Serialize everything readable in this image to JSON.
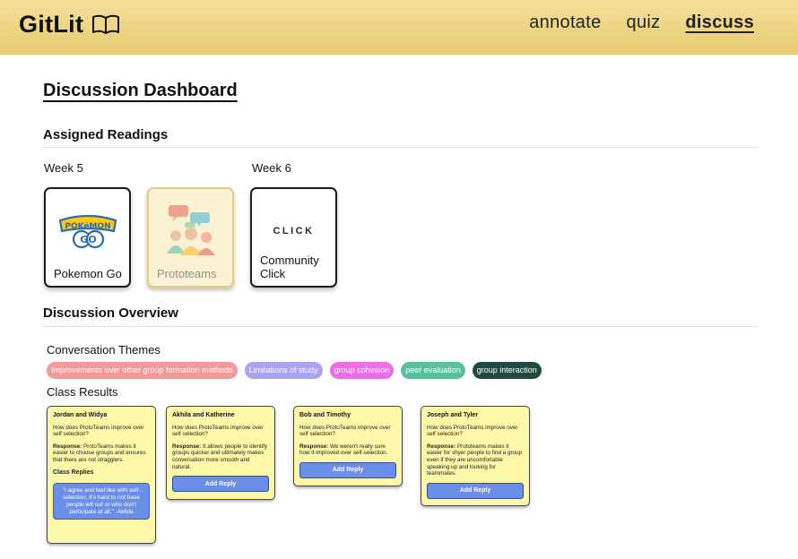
{
  "header": {
    "brand": "GitLit",
    "nav": [
      {
        "label": "annotate",
        "active": false
      },
      {
        "label": "quiz",
        "active": false
      },
      {
        "label": "discuss",
        "active": true
      }
    ]
  },
  "page_title": "Discussion Dashboard",
  "assigned": {
    "title": "Assigned Readings",
    "weeks": [
      {
        "label": "Week 5"
      },
      {
        "label": "Week 6"
      }
    ],
    "cards": [
      {
        "label": "Pokemon Go",
        "image": "pokemon-go-logo",
        "selected": false
      },
      {
        "label": "Prototeams",
        "image": "people-chat-illustration",
        "selected": true
      },
      {
        "label": "Community Click",
        "image": "click-logo",
        "logo_text": "CLICK",
        "selected": false
      }
    ]
  },
  "overview": {
    "title": "Discussion Overview",
    "themes_title": "Conversation Themes",
    "themes": [
      {
        "label": "Improvements over other group formation methods",
        "color": "#f19a9a"
      },
      {
        "label": "Limitations of study",
        "color": "#a9a3f0"
      },
      {
        "label": "group cohesion",
        "color": "#ea6fe3"
      },
      {
        "label": "peer evaluation",
        "color": "#5bbf9f"
      },
      {
        "label": "group interaction",
        "color": "#234a40"
      }
    ],
    "results_title": "Class Results",
    "results": [
      {
        "names": "Jordan and Widya",
        "question": "How does ProtoTeams improve over self selection?",
        "response_label": "Response:",
        "response": "ProtoTeams makes it easier to choose groups and ensures that there are not stragglers.",
        "replies_title": "Class Replies",
        "reply": "\"I agree and feel like with self-selection, it's hard to not have people left out or who don't participate at all.\" -Akhila"
      },
      {
        "names": "Akhila and Katherine",
        "question": "How does ProtoTeams improve over self selection?",
        "response_label": "Response:",
        "response": "It allows people to identify groups quicker and ultimately makes conversation more smooth and natural.",
        "button": "Add Reply"
      },
      {
        "names": "Bob and Timothy",
        "question": "How does ProtoTeams improve over self selection?",
        "response_label": "Response:",
        "response": "We weren't really sure how it improved over self-selection.",
        "button": "Add Reply"
      },
      {
        "names": "Joseph and Tyler",
        "question": "How does ProtoTeams improve over self selection?",
        "response_label": "Response:",
        "response": "Prototeams makes it easier for shyer people to find a group even if they are uncomfortable speaking up and looking for teammates.",
        "button": "Add Reply"
      }
    ]
  },
  "colors": {
    "header_bg": "#ecd37f",
    "button": "#6b8ee8",
    "result_card_bg": "#fdf7a8"
  }
}
